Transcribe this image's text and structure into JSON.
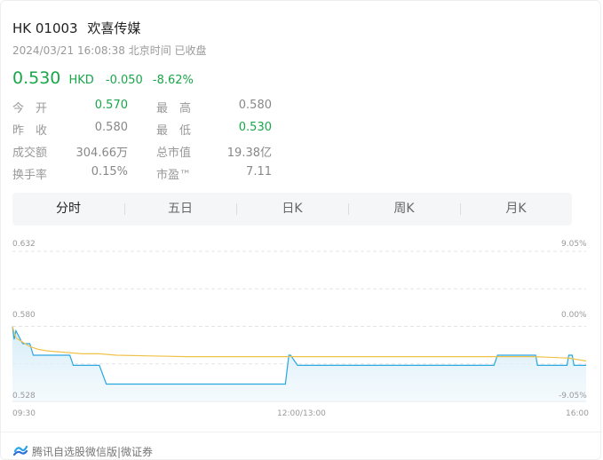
{
  "header": {
    "code": "HK 01003",
    "name": "欢喜传媒",
    "timestamp": "2024/03/21 16:08:38 北京时间 已收盘"
  },
  "quote": {
    "price": "0.530",
    "currency": "HKD",
    "change": "-0.050",
    "change_pct": "-8.62%"
  },
  "stats": [
    {
      "label1": "今　开",
      "value1": "0.570",
      "label2": "最　高",
      "value2": "0.580"
    },
    {
      "label1": "昨　收",
      "value1": "0.580",
      "label2": "最　低",
      "value2": "0.530"
    },
    {
      "label1": "成交额",
      "value1": "304.66万",
      "label2": "总市值",
      "value2": "19.38亿"
    },
    {
      "label1": "换手率",
      "value1": "0.15%",
      "label2": "市盈™",
      "value2": "7.11"
    }
  ],
  "tabs": [
    "分时",
    "五日",
    "日K",
    "周K",
    "月K"
  ],
  "active_tab": 0,
  "chart_data": {
    "type": "line",
    "y_ticks_left": [
      "0.632",
      "0.580",
      "0.528"
    ],
    "y_ticks_right": [
      "9.05%",
      "0.00%",
      "-9.05%"
    ],
    "x_ticks": [
      "09:30",
      "12:00/13:00",
      "16:00"
    ],
    "ylim": [
      0.528,
      0.632
    ],
    "prev_close": 0.58,
    "series": [
      {
        "color": "#29a8e0",
        "fill": true,
        "x": [
          0,
          1,
          2,
          5,
          6,
          10,
          12,
          33,
          35,
          50,
          54,
          55,
          58,
          100,
          157,
          159,
          160,
          164,
          175,
          277,
          279,
          280,
          282,
          284,
          286,
          299,
          300,
          301,
          302,
          304,
          319,
          320,
          321,
          322,
          323,
          325,
          328,
          330
        ],
        "y": [
          0.58,
          0.571,
          0.577,
          0.57,
          0.568,
          0.568,
          0.56,
          0.56,
          0.553,
          0.553,
          0.54,
          0.54,
          0.54,
          0.54,
          0.54,
          0.56,
          0.56,
          0.553,
          0.553,
          0.553,
          0.56,
          0.56,
          0.56,
          0.56,
          0.56,
          0.56,
          0.56,
          0.56,
          0.553,
          0.553,
          0.553,
          0.56,
          0.56,
          0.56,
          0.553,
          0.553,
          0.553,
          0.553
        ]
      },
      {
        "color": "#f0c24a",
        "fill": false,
        "x": [
          0,
          2,
          6,
          10,
          15,
          20,
          30,
          40,
          50,
          60,
          80,
          100,
          150,
          200,
          250,
          300,
          310,
          320,
          325,
          330
        ],
        "y": [
          0.58,
          0.572,
          0.569,
          0.566,
          0.564,
          0.563,
          0.562,
          0.561,
          0.561,
          0.56,
          0.5595,
          0.559,
          0.559,
          0.559,
          0.559,
          0.559,
          0.5585,
          0.558,
          0.557,
          0.556
        ]
      }
    ]
  },
  "footer": {
    "text": "腾讯自选股微信版|微证券",
    "icon": "tencent-stock-logo-icon"
  }
}
